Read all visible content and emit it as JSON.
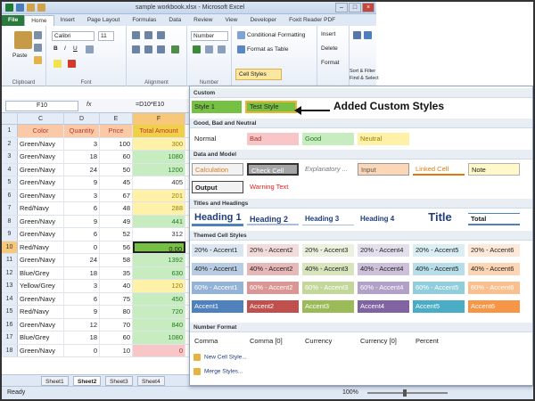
{
  "window": {
    "title": "sample workbook.xlsx - Microsoft Excel"
  },
  "tabs": [
    "File",
    "Home",
    "Insert",
    "Page Layout",
    "Formulas",
    "Data",
    "Review",
    "View",
    "Developer",
    "Foxit Reader PDF"
  ],
  "ribbon": {
    "clipboard": {
      "paste": "Paste",
      "label": "Clipboard"
    },
    "font": {
      "name": "Calibri",
      "size": "11",
      "label": "Font"
    },
    "alignment": {
      "label": "Alignment"
    },
    "number": {
      "format": "Number",
      "label": "Number"
    },
    "styles": {
      "conditional": "Conditional Formatting",
      "format_table": "Format as Table",
      "cell_styles": "Cell Styles"
    },
    "cells": {
      "insert": "Insert",
      "delete": "Delete",
      "format": "Format"
    },
    "editing": {
      "sort": "Sort & Filter",
      "find": "Find & Select"
    }
  },
  "formula_bar": {
    "name_box": "F10",
    "fx": "fx",
    "formula": "=D10*E10"
  },
  "columns": [
    "C",
    "D",
    "E",
    "F"
  ],
  "headers": [
    "Color",
    "Quantity",
    "Price",
    "Total Amount"
  ],
  "rows": [
    {
      "num": "2",
      "color": "Green/Navy",
      "qty": "3",
      "price": "100",
      "total": "300",
      "tone": "yellow"
    },
    {
      "num": "3",
      "color": "Green/Navy",
      "qty": "18",
      "price": "60",
      "total": "1080",
      "tone": "green"
    },
    {
      "num": "4",
      "color": "Green/Navy",
      "qty": "24",
      "price": "50",
      "total": "1200",
      "tone": "green"
    },
    {
      "num": "5",
      "color": "Green/Navy",
      "qty": "9",
      "price": "45",
      "total": "405",
      "tone": "plain"
    },
    {
      "num": "6",
      "color": "Green/Navy",
      "qty": "3",
      "price": "67",
      "total": "201",
      "tone": "yellow"
    },
    {
      "num": "7",
      "color": "Red/Navy",
      "qty": "6",
      "price": "48",
      "total": "288",
      "tone": "yellow"
    },
    {
      "num": "8",
      "color": "Green/Navy",
      "qty": "9",
      "price": "49",
      "total": "441",
      "tone": "green"
    },
    {
      "num": "9",
      "color": "Green/Navy",
      "qty": "6",
      "price": "52",
      "total": "312",
      "tone": "plain"
    },
    {
      "num": "10",
      "color": "Red/Navy",
      "qty": "0",
      "price": "56",
      "total": "0.00",
      "tone": "sel"
    },
    {
      "num": "11",
      "color": "Green/Navy",
      "qty": "24",
      "price": "58",
      "total": "1392",
      "tone": "green"
    },
    {
      "num": "12",
      "color": "Blue/Grey",
      "qty": "18",
      "price": "35",
      "total": "630",
      "tone": "green"
    },
    {
      "num": "13",
      "color": "Yellow/Grey",
      "qty": "3",
      "price": "40",
      "total": "120",
      "tone": "yellow"
    },
    {
      "num": "14",
      "color": "Green/Navy",
      "qty": "6",
      "price": "75",
      "total": "450",
      "tone": "green"
    },
    {
      "num": "15",
      "color": "Red/Navy",
      "qty": "9",
      "price": "80",
      "total": "720",
      "tone": "green"
    },
    {
      "num": "16",
      "color": "Green/Navy",
      "qty": "12",
      "price": "70",
      "total": "840",
      "tone": "green"
    },
    {
      "num": "17",
      "color": "Blue/Grey",
      "qty": "18",
      "price": "60",
      "total": "1080",
      "tone": "green"
    },
    {
      "num": "18",
      "color": "Green/Navy",
      "qty": "0",
      "price": "10",
      "total": "0",
      "tone": "red"
    }
  ],
  "sheets": [
    "Sheet1",
    "Sheet2",
    "Sheet3",
    "Sheet4"
  ],
  "status": {
    "ready": "Ready",
    "zoom": "100%"
  },
  "gallery": {
    "sections": {
      "custom": "Custom",
      "good_bad": "Good, Bad and Neutral",
      "data_model": "Data and Model",
      "titles": "Titles and Headings",
      "themed": "Themed Cell Styles",
      "number": "Number Format"
    },
    "custom": [
      "Style 1",
      "Test Style"
    ],
    "good_bad": [
      "Normal",
      "Bad",
      "Good",
      "Neutral"
    ],
    "data_model_row1": [
      "Calculation",
      "Check Cell",
      "Explanatory ...",
      "Input",
      "Linked Cell",
      "Note"
    ],
    "data_model_row2": [
      "Output",
      "Warning Text"
    ],
    "titles": [
      "Heading 1",
      "Heading 2",
      "Heading 3",
      "Heading 4",
      "Title",
      "Total"
    ],
    "themed_row1": [
      "20% - Accent1",
      "20% - Accent2",
      "20% - Accent3",
      "20% - Accent4",
      "20% - Accent5",
      "20% - Accent6"
    ],
    "themed_row2": [
      "40% - Accent1",
      "40% - Accent2",
      "40% - Accent3",
      "40% - Accent4",
      "40% - Accent5",
      "40% - Accent6"
    ],
    "themed_row3": [
      "60% - Accent1",
      "60% - Accent2",
      "60% - Accent3",
      "60% - Accent4",
      "60% - Accent5",
      "60% - Accent6"
    ],
    "themed_row4": [
      "Accent1",
      "Accent2",
      "Accent3",
      "Accent4",
      "Accent5",
      "Accent6"
    ],
    "number": [
      "Comma",
      "Comma [0]",
      "Currency",
      "Currency [0]",
      "Percent"
    ],
    "menu": [
      "New Cell Style...",
      "Merge Styles..."
    ]
  },
  "annotation": "Added Custom Styles"
}
